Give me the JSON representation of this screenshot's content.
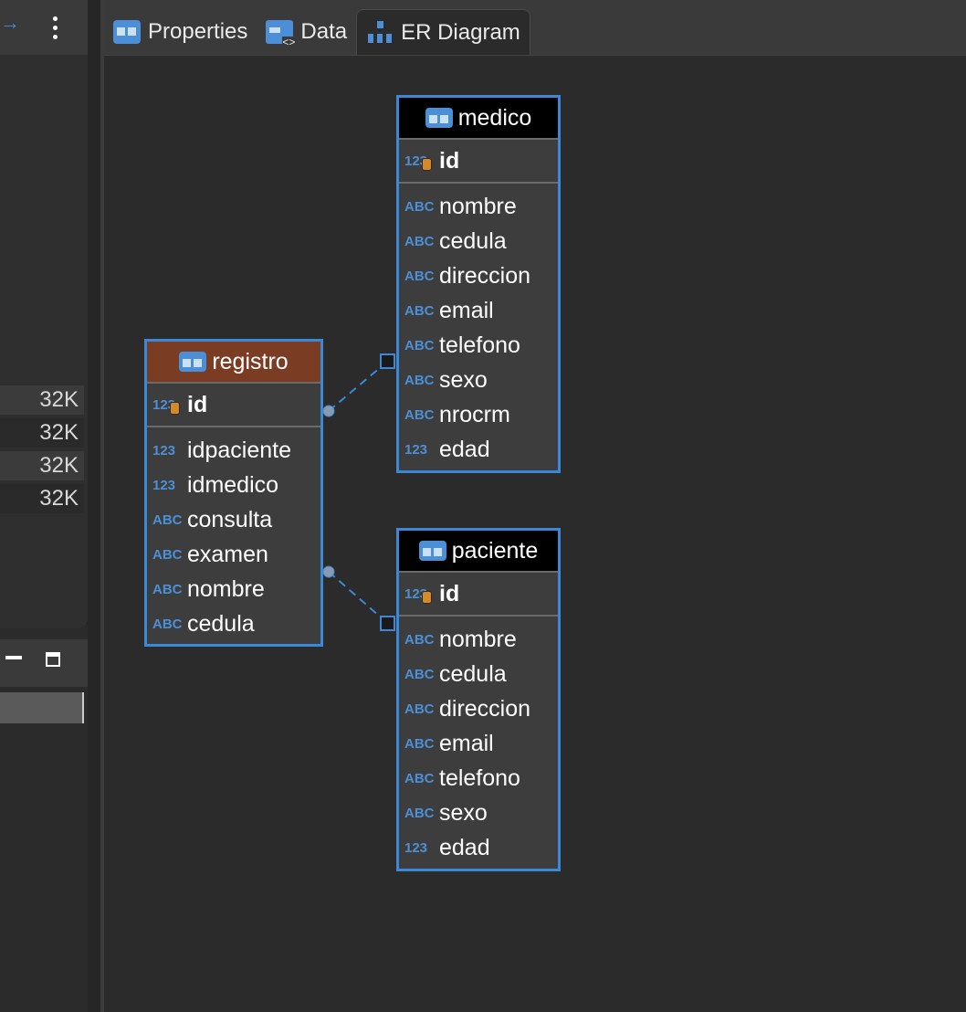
{
  "tabs": [
    {
      "label": "Properties",
      "icon": "table-icon",
      "active": false
    },
    {
      "label": "Data",
      "icon": "data-grid-icon",
      "active": false
    },
    {
      "label": "ER Diagram",
      "icon": "er-diagram-icon",
      "active": true
    }
  ],
  "left_panel": {
    "sizes": [
      "32K",
      "32K",
      "32K",
      "32K"
    ]
  },
  "entities": {
    "medico": {
      "name": "medico",
      "pk": {
        "type": "123",
        "name": "id"
      },
      "columns": [
        {
          "type": "ABC",
          "name": "nombre"
        },
        {
          "type": "ABC",
          "name": "cedula"
        },
        {
          "type": "ABC",
          "name": "direccion"
        },
        {
          "type": "ABC",
          "name": "email"
        },
        {
          "type": "ABC",
          "name": "telefono"
        },
        {
          "type": "ABC",
          "name": "sexo"
        },
        {
          "type": "ABC",
          "name": "nrocrm"
        },
        {
          "type": "123",
          "name": "edad"
        }
      ]
    },
    "registro": {
      "name": "registro",
      "pk": {
        "type": "123",
        "name": "id"
      },
      "columns": [
        {
          "type": "123",
          "name": "idpaciente"
        },
        {
          "type": "123",
          "name": "idmedico"
        },
        {
          "type": "ABC",
          "name": "consulta"
        },
        {
          "type": "ABC",
          "name": "examen"
        },
        {
          "type": "ABC",
          "name": "nombre"
        },
        {
          "type": "ABC",
          "name": "cedula"
        }
      ]
    },
    "paciente": {
      "name": "paciente",
      "pk": {
        "type": "123",
        "name": "id"
      },
      "columns": [
        {
          "type": "ABC",
          "name": "nombre"
        },
        {
          "type": "ABC",
          "name": "cedula"
        },
        {
          "type": "ABC",
          "name": "direccion"
        },
        {
          "type": "ABC",
          "name": "email"
        },
        {
          "type": "ABC",
          "name": "telefono"
        },
        {
          "type": "ABC",
          "name": "sexo"
        },
        {
          "type": "123",
          "name": "edad"
        }
      ]
    }
  },
  "colors": {
    "entity_border": "#3a88d6",
    "header_default": "#000000",
    "header_selected": "#7b3c24",
    "type_label": "#4c8fd6",
    "link": "#3a88d6"
  }
}
